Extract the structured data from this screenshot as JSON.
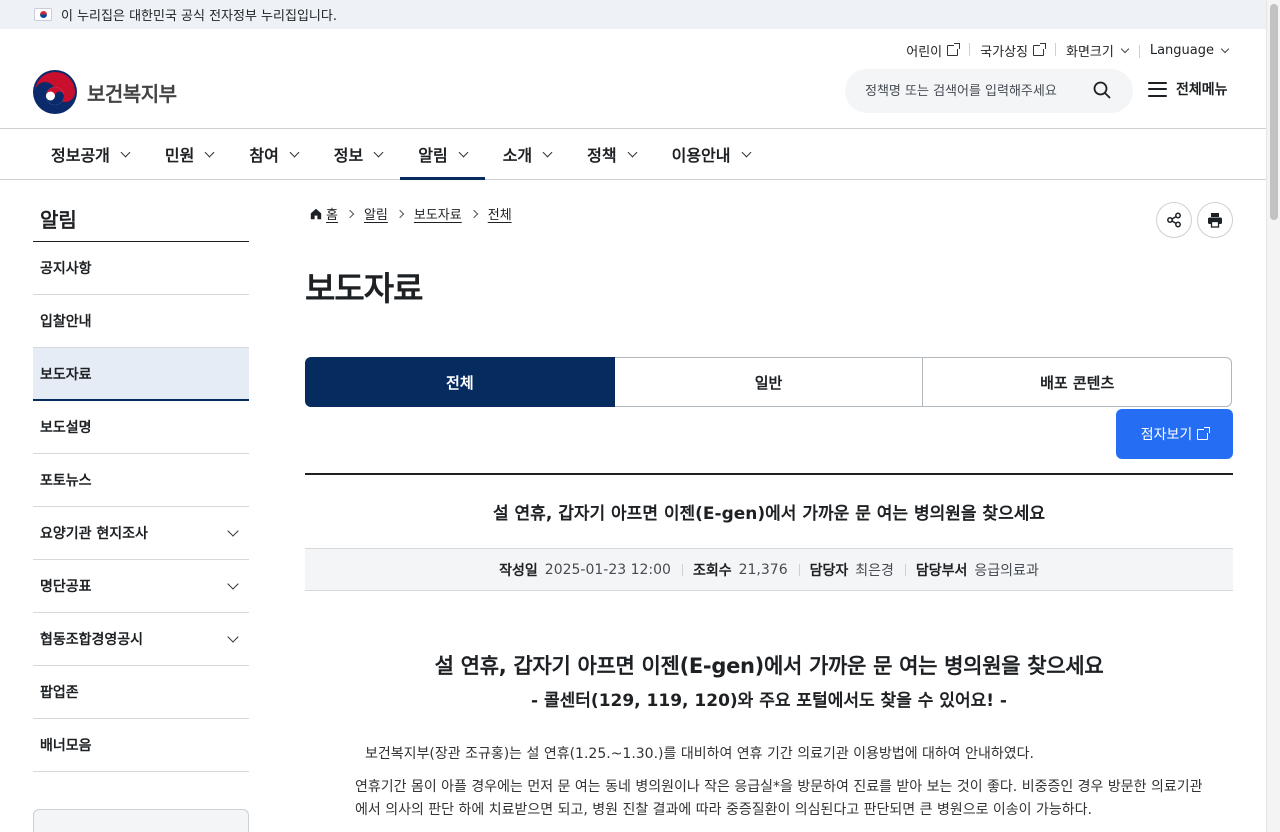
{
  "gov_banner": {
    "text": "이 누리집은 대한민국 공식 전자정부 누리집입니다."
  },
  "util": {
    "kids": "어린이",
    "symbols": "국가상징",
    "screen_size": "화면크기",
    "language": "Language"
  },
  "logo": {
    "name": "보건복지부"
  },
  "search": {
    "placeholder": "정책명 또는 검색어를 입력해주세요"
  },
  "all_menu": "전체메뉴",
  "gnb": [
    "정보공개",
    "민원",
    "참여",
    "정보",
    "알림",
    "소개",
    "정책",
    "이용안내"
  ],
  "lnb": {
    "title": "알림",
    "items": [
      "공지사항",
      "입찰안내",
      "보도자료",
      "보도설명",
      "포토뉴스",
      "요양기관 현지조사",
      "명단공표",
      "협동조합경영공시",
      "팝업존",
      "배너모음"
    ]
  },
  "breadcrumb": [
    "홈",
    "알림",
    "보도자료",
    "전체"
  ],
  "page_title": "보도자료",
  "tabs": [
    "전체",
    "일반",
    "배포 콘텐츠"
  ],
  "braille_button": "점자보기",
  "article": {
    "title": "설 연휴, 갑자기 아프면 이젠(E-gen)에서 가까운 문 여는 병의원을 찾으세요",
    "meta": {
      "date_label": "작성일",
      "date": "2025-01-23 12:00",
      "views_label": "조회수",
      "views": "21,376",
      "manager_label": "담당자",
      "manager": "최은경",
      "dept_label": "담당부서",
      "dept": "응급의료과"
    },
    "body_title": "설 연휴, 갑자기 아프면 이젠(E-gen)에서 가까운 문 여는 병의원을 찾으세요",
    "body_subtitle": "- 콜센터(129, 119, 120)와 주요 포털에서도 찾을 수 있어요! -",
    "para1": "보건복지부(장관 조규홍)는 설 연휴(1.25.~1.30.)를 대비하여 연휴 기간 의료기관 이용방법에 대하여 안내하였다.",
    "para2": "연휴기간 몸이 아플 경우에는 먼저 문 여는 동네 병의원이나 작은 응급실*을 방문하여 진료를 받아 보는 것이 좋다. 비중증인 경우 방문한 의료기관에서 의사의 판단 하에 치료받으면 되고, 병원 진찰 결과에 따라 중증질환이 의심된다고 판단되면 큰 병원으로 이송이 가능하다."
  }
}
